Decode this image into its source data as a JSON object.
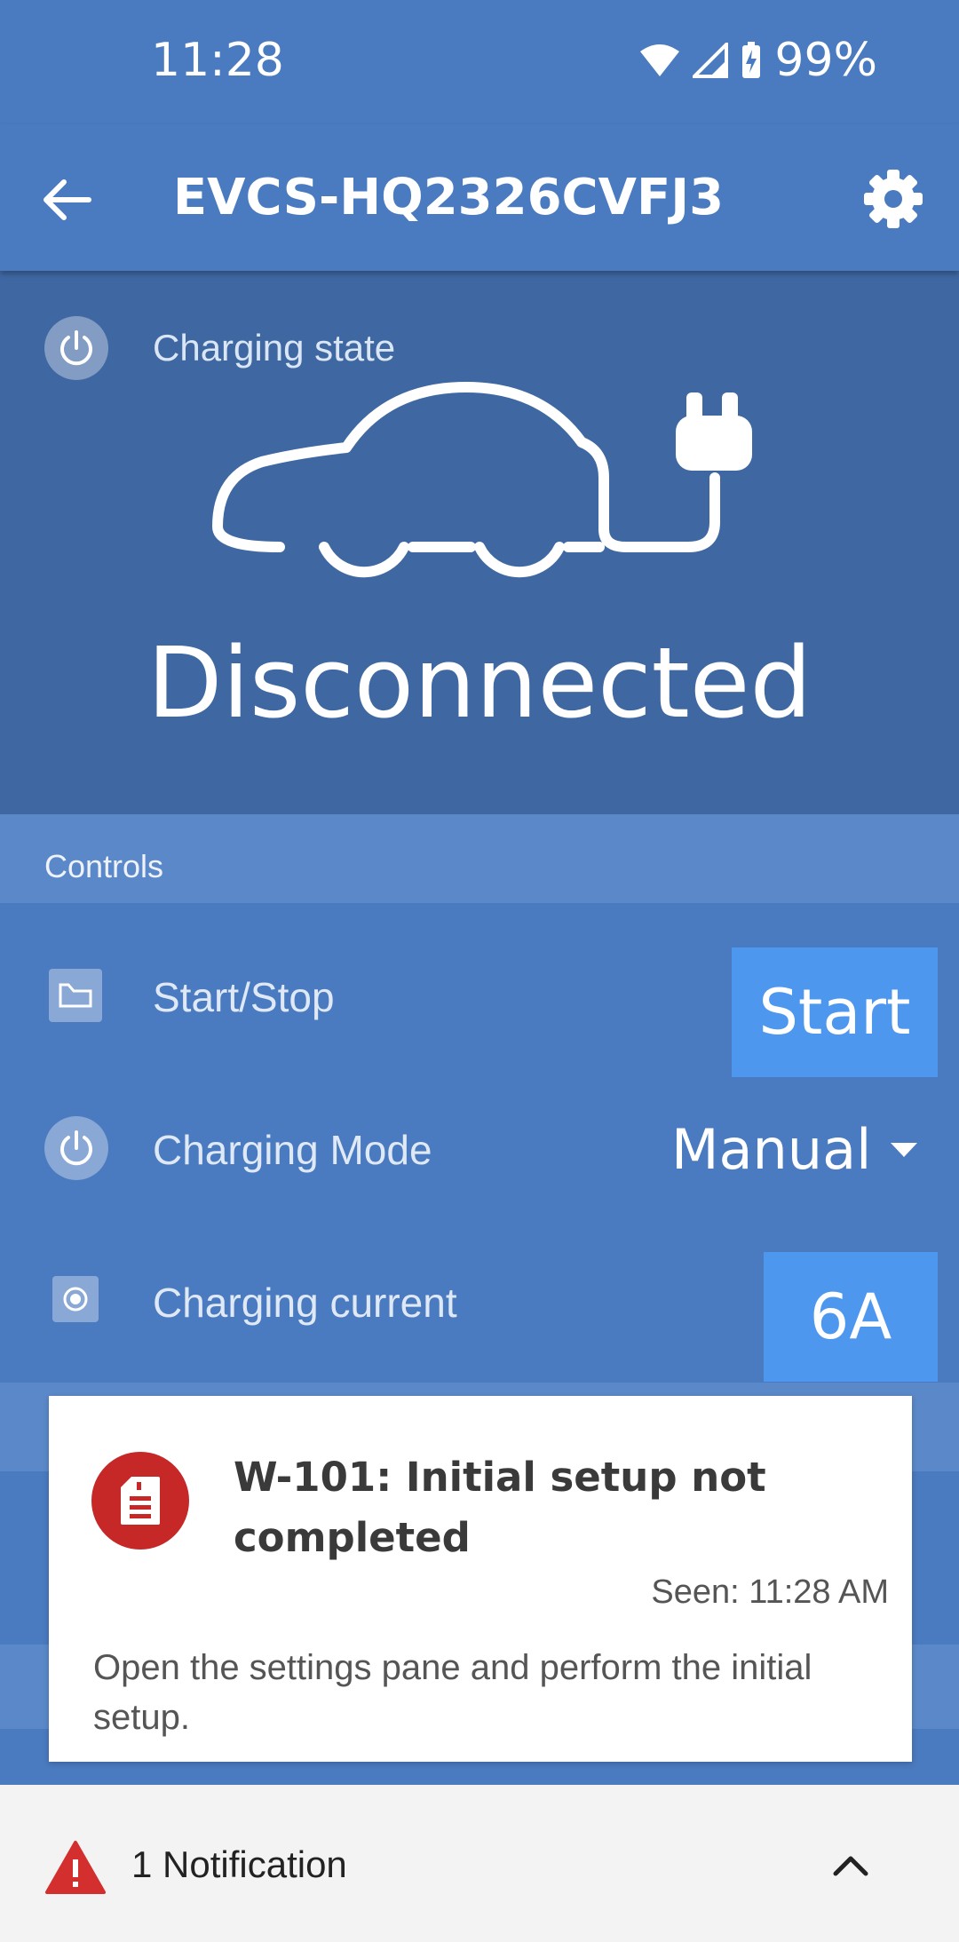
{
  "status_bar": {
    "time": "11:28",
    "battery": "99%"
  },
  "app_bar": {
    "title": "EVCS-HQ2326CVFJ3",
    "back_icon": "arrow-back-icon",
    "settings_icon": "gear-icon"
  },
  "charging_state": {
    "label": "Charging state",
    "value": "Disconnected",
    "illustration": "car-plug-icon"
  },
  "controls": {
    "section_title": "Controls",
    "start_stop": {
      "label": "Start/Stop",
      "button": "Start"
    },
    "charging_mode": {
      "label": "Charging Mode",
      "value": "Manual"
    },
    "charging_current": {
      "label": "Charging current",
      "value": "6A"
    }
  },
  "notification_card": {
    "title": "W-101: Initial setup not completed",
    "seen": "Seen: 11:28 AM",
    "body": "Open the settings pane and perform the initial setup.",
    "icon": "document-alert-icon",
    "icon_color": "#c62828"
  },
  "bottom_bar": {
    "label": "1 Notification",
    "warn_color": "#d32f2f"
  },
  "colors": {
    "primary": "#4a7abf",
    "state_panel": "#3f68a3",
    "section_header": "#5b88c8",
    "accent_button": "#4e97ef"
  }
}
